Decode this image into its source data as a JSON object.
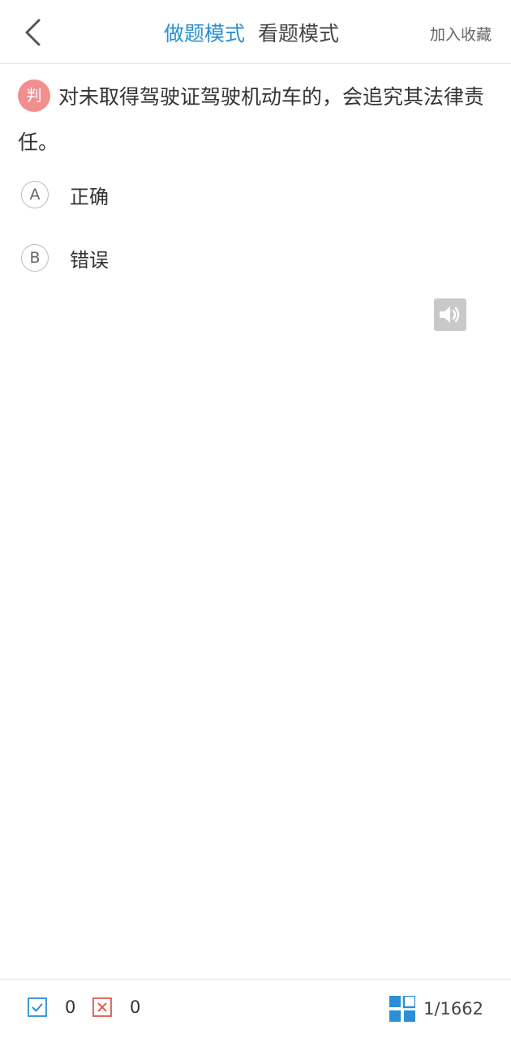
{
  "header": {
    "back_icon": "chevron-left-icon",
    "tabs": [
      {
        "label": "做题模式",
        "active": true
      },
      {
        "label": "看题模式",
        "active": false
      }
    ],
    "favorite_label": "加入收藏"
  },
  "question": {
    "type_badge": "判",
    "text": "对未取得驾驶证驾驶机动车的，会追究其法律责任。",
    "options": [
      {
        "key": "A",
        "label": "正确"
      },
      {
        "key": "B",
        "label": "错误"
      }
    ],
    "audio_icon": "speaker-icon"
  },
  "footer": {
    "correct_count": "0",
    "wrong_count": "0",
    "progress": "1/1662"
  },
  "colors": {
    "accent": "#2a8fd6",
    "badge": "#f18f8f",
    "wrong": "#e05a4f"
  }
}
